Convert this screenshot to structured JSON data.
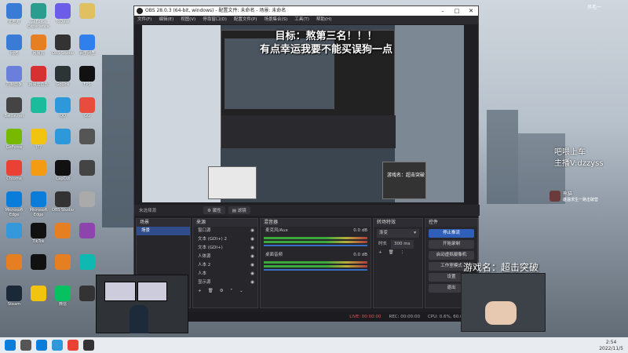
{
  "desktop": {
    "icons": [
      {
        "label": "此电脑",
        "icon": "computer-icon",
        "color": "#3a7bd5"
      },
      {
        "label": "GeForce Experience",
        "icon": "geforce-icon",
        "color": "#2a9d8f"
      },
      {
        "label": "ToDesk",
        "icon": "remote-icon",
        "color": "#6c5ce7"
      },
      {
        "label": "",
        "icon": "folder-icon",
        "color": "#e0c060"
      },
      {
        "label": "网络",
        "icon": "network-icon",
        "color": "#3a7bd5"
      },
      {
        "label": "网易云",
        "icon": "music-icon",
        "color": "#e67e22"
      },
      {
        "label": "OBS Studio",
        "icon": "obs-icon",
        "color": "#333333"
      },
      {
        "label": "百度网盘",
        "icon": "cloud-icon",
        "color": "#2f80ed"
      },
      {
        "label": "控制面板",
        "icon": "control-icon",
        "color": "#6a7fdb"
      },
      {
        "label": "网易云音乐",
        "icon": "netease-icon",
        "color": "#d63031"
      },
      {
        "label": "GoLink",
        "icon": "accelerator-icon",
        "color": "#2d3436"
      },
      {
        "label": "FPS",
        "icon": "fps-icon",
        "color": "#111111"
      },
      {
        "label": "Battle.net",
        "icon": "game-icon",
        "color": "#444444"
      },
      {
        "label": "",
        "icon": "app-icon",
        "color": "#1abc9c"
      },
      {
        "label": "QQ",
        "icon": "qq-icon",
        "color": "#2d98da"
      },
      {
        "label": "GG",
        "icon": "gg-icon",
        "color": "#e74c3c"
      },
      {
        "label": "GeForce",
        "icon": "nvidia-icon",
        "color": "#76b900"
      },
      {
        "label": "???",
        "icon": "file-icon",
        "color": "#f1c40f"
      },
      {
        "label": "",
        "icon": "bird-icon",
        "color": "#2d98da"
      },
      {
        "label": "",
        "icon": "game-icon",
        "color": "#555555"
      },
      {
        "label": "Chrome",
        "icon": "chrome-icon",
        "color": "#e94235"
      },
      {
        "label": "",
        "icon": "app-icon",
        "color": "#f39c12"
      },
      {
        "label": "CapCut",
        "icon": "capcut-icon",
        "color": "#111111"
      },
      {
        "label": "",
        "icon": "app-icon",
        "color": "#444444"
      },
      {
        "label": "Microsoft Edge",
        "icon": "edge-icon",
        "color": "#0a7cd9"
      },
      {
        "label": "Microsoft Edge",
        "icon": "edge-icon",
        "color": "#0a7cd9"
      },
      {
        "label": "OBS Studio",
        "icon": "obs-icon",
        "color": "#333333"
      },
      {
        "label": "",
        "icon": "file-icon",
        "color": "#aaaaaa"
      },
      {
        "label": "",
        "icon": "app-icon",
        "color": "#3498db"
      },
      {
        "label": "TikTok",
        "icon": "tiktok-icon",
        "color": "#111111"
      },
      {
        "label": "",
        "icon": "game-icon",
        "color": "#e67e22"
      },
      {
        "label": "",
        "icon": "game-icon",
        "color": "#8e44ad"
      },
      {
        "label": "",
        "icon": "app-icon",
        "color": "#e67e22"
      },
      {
        "label": "",
        "icon": "logitech-icon",
        "color": "#111111"
      },
      {
        "label": "",
        "icon": "game-icon",
        "color": "#e67e22"
      },
      {
        "label": "",
        "icon": "app-icon",
        "color": "#0fb9b1"
      },
      {
        "label": "Steam",
        "icon": "steam-icon",
        "color": "#1b2838"
      },
      {
        "label": "",
        "icon": "game-icon",
        "color": "#f1c40f"
      },
      {
        "label": "微信",
        "icon": "wechat-icon",
        "color": "#07c160"
      },
      {
        "label": "",
        "icon": "app-icon",
        "color": "#333333"
      }
    ]
  },
  "obs": {
    "title": "OBS 28.0.3 (64-bit, windows) - 配置文件: 未命名 - 场景: 未命名",
    "menu": [
      "文件(F)",
      "编辑(E)",
      "视图(V)",
      "停靠窗口(D)",
      "配置文件(P)",
      "场景集合(S)",
      "工具(T)",
      "帮助(H)"
    ],
    "preview_overlay_line1": "目标：熬第三名！！！",
    "preview_overlay_line2": "有点幸运我要不能买误狗一点",
    "preview_game_label": "游戏名：超击突破",
    "scene_bar": {
      "current": "未选择源",
      "props": "属性",
      "filters": "滤镜"
    },
    "scenes": {
      "title": "场景",
      "items": [
        "场景"
      ]
    },
    "sources": {
      "title": "来源",
      "items": [
        "窗口源",
        "文本 (GDI+) 2",
        "文本 (GDI+)",
        "人体源",
        "人本 2",
        "人本",
        "显示源"
      ]
    },
    "mixer": {
      "title": "混音器",
      "channels": [
        {
          "name": "麦克风/Aux",
          "db": "0.0 dB"
        },
        {
          "name": "桌面音频",
          "db": "0.0 dB"
        }
      ]
    },
    "transitions": {
      "title": "转场特效",
      "type": "渐变",
      "duration_label": "时长",
      "duration": "300 ms"
    },
    "controls": {
      "title": "控件",
      "buttons": [
        "停止推流",
        "开始录制",
        "启动虚拟摄像机",
        "工作室模式",
        "设置",
        "退出"
      ]
    },
    "status": {
      "live": "LIVE: 00:00:00",
      "rec": "REC: 00:00:00",
      "cpu": "CPU: 0.6%, 60.00 fps"
    }
  },
  "overlay": {
    "stream_text_line1": "吧喂上车",
    "stream_text_line2": "主播V:dzzyss",
    "game_label": "游戏名：超击突破",
    "viewer_name": "熊猫",
    "viewer_sub": "雄温求生一路击破营",
    "corner_text": "吊毛一"
  },
  "taskbar": {
    "icons": [
      {
        "icon": "windows-start-icon",
        "color": "#0a7cd9"
      },
      {
        "icon": "search-icon",
        "color": "#555555"
      },
      {
        "icon": "edge-icon",
        "color": "#0a7cd9"
      },
      {
        "icon": "store-icon",
        "color": "#2d98da"
      },
      {
        "icon": "chrome-icon",
        "color": "#e94235"
      },
      {
        "icon": "obs-icon",
        "color": "#333333"
      }
    ],
    "time": "2:54",
    "date": "2022/11/5"
  }
}
